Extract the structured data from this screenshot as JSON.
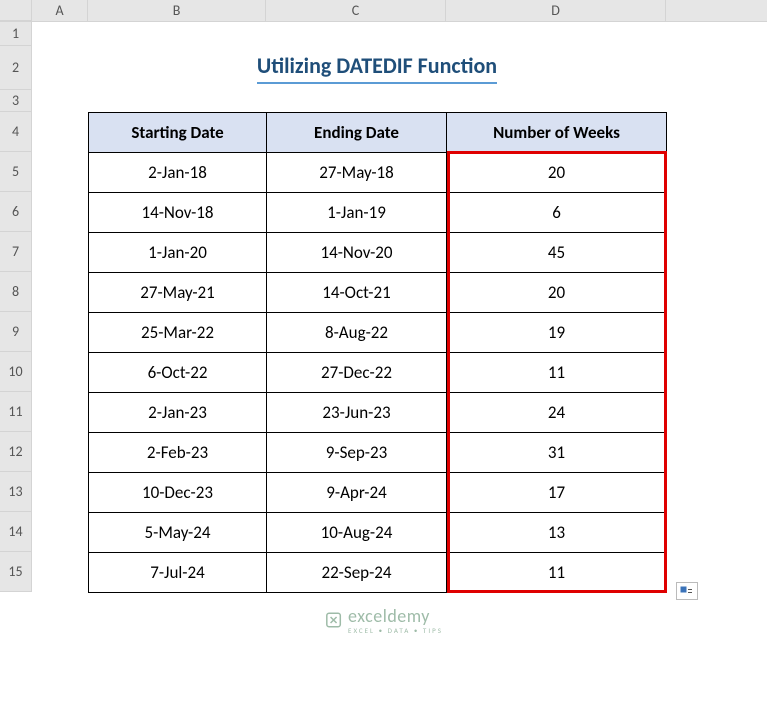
{
  "columns": {
    "A": "A",
    "B": "B",
    "C": "C",
    "D": "D"
  },
  "rows": [
    "1",
    "2",
    "3",
    "4",
    "5",
    "6",
    "7",
    "8",
    "9",
    "10",
    "11",
    "12",
    "13",
    "14",
    "15"
  ],
  "title": "Utilizing DATEDIF Function",
  "headers": {
    "start": "Starting Date",
    "end": "Ending Date",
    "weeks": "Number of Weeks"
  },
  "data": [
    {
      "start": "2-Jan-18",
      "end": "27-May-18",
      "weeks": "20"
    },
    {
      "start": "14-Nov-18",
      "end": "1-Jan-19",
      "weeks": "6"
    },
    {
      "start": "1-Jan-20",
      "end": "14-Nov-20",
      "weeks": "45"
    },
    {
      "start": "27-May-21",
      "end": "14-Oct-21",
      "weeks": "20"
    },
    {
      "start": "25-Mar-22",
      "end": "8-Aug-22",
      "weeks": "19"
    },
    {
      "start": "6-Oct-22",
      "end": "27-Dec-22",
      "weeks": "11"
    },
    {
      "start": "2-Jan-23",
      "end": "23-Jun-23",
      "weeks": "24"
    },
    {
      "start": "2-Feb-23",
      "end": "9-Sep-23",
      "weeks": "31"
    },
    {
      "start": "10-Dec-23",
      "end": "9-Apr-24",
      "weeks": "17"
    },
    {
      "start": "5-May-24",
      "end": "10-Aug-24",
      "weeks": "13"
    },
    {
      "start": "7-Jul-24",
      "end": "22-Sep-24",
      "weeks": "11"
    }
  ],
  "watermark": {
    "brand": "exceldemy",
    "sub": "EXCEL • DATA • TIPS"
  },
  "chart_data": {
    "type": "table",
    "title": "Utilizing DATEDIF Function",
    "columns": [
      "Starting Date",
      "Ending Date",
      "Number of Weeks"
    ],
    "rows": [
      [
        "2-Jan-18",
        "27-May-18",
        20
      ],
      [
        "14-Nov-18",
        "1-Jan-19",
        6
      ],
      [
        "1-Jan-20",
        "14-Nov-20",
        45
      ],
      [
        "27-May-21",
        "14-Oct-21",
        20
      ],
      [
        "25-Mar-22",
        "8-Aug-22",
        19
      ],
      [
        "6-Oct-22",
        "27-Dec-22",
        11
      ],
      [
        "2-Jan-23",
        "23-Jun-23",
        24
      ],
      [
        "2-Feb-23",
        "9-Sep-23",
        31
      ],
      [
        "10-Dec-23",
        "9-Apr-24",
        17
      ],
      [
        "5-May-24",
        "10-Aug-24",
        13
      ],
      [
        "7-Jul-24",
        "22-Sep-24",
        11
      ]
    ]
  }
}
